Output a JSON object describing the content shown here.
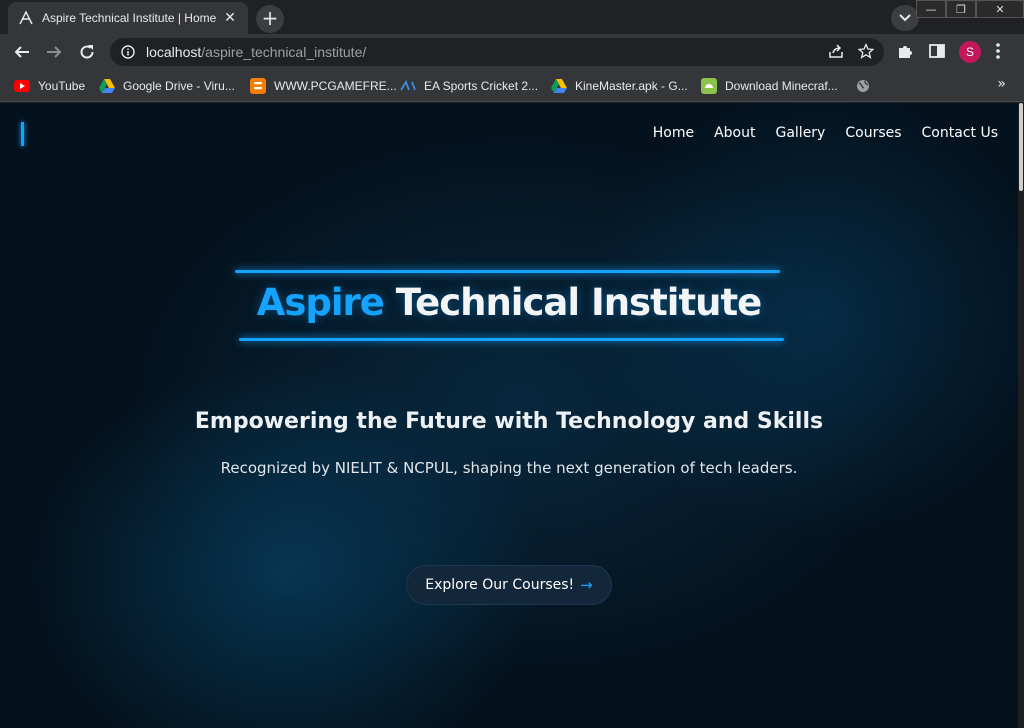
{
  "browser": {
    "tab": {
      "title": "Aspire Technical Institute | Home",
      "close": "✕"
    },
    "new_tab": "+",
    "url": {
      "host": "localhost",
      "path": "/aspire_technical_institute/"
    },
    "profile_initial": "S",
    "window_controls": {
      "minimize": "—",
      "restore": "❐",
      "close": "✕"
    },
    "bookmarks": [
      {
        "label": "YouTube",
        "icon": "youtube-icon"
      },
      {
        "label": "Google Drive - Viru...",
        "icon": "google-drive-icon"
      },
      {
        "label": "WWW.PCGAMEFRE...",
        "icon": "blogger-icon"
      },
      {
        "label": "EA Sports Cricket 2...",
        "icon": "ea-icon"
      },
      {
        "label": "KineMaster.apk - G...",
        "icon": "google-drive-icon"
      },
      {
        "label": "Download Minecraf...",
        "icon": "android-icon"
      },
      {
        "label": "",
        "icon": "globe-icon"
      }
    ],
    "bookmarks_more": "»"
  },
  "site": {
    "nav": [
      "Home",
      "About",
      "Gallery",
      "Courses",
      "Contact Us"
    ],
    "hero": {
      "title_accent": "Aspire",
      "title_rest": " Technical Institute",
      "subtitle": "Empowering the Future with Technology and Skills",
      "description": "Recognized by NIELIT & NCPUL, shaping the next generation of tech leaders.",
      "cta_label": "Explore Our Courses!",
      "cta_arrow": "→"
    }
  },
  "colors": {
    "accent": "#14a4ff",
    "page_background": "#04121e",
    "chrome_dark": "#202124",
    "chrome_toolbar": "#35363a"
  }
}
